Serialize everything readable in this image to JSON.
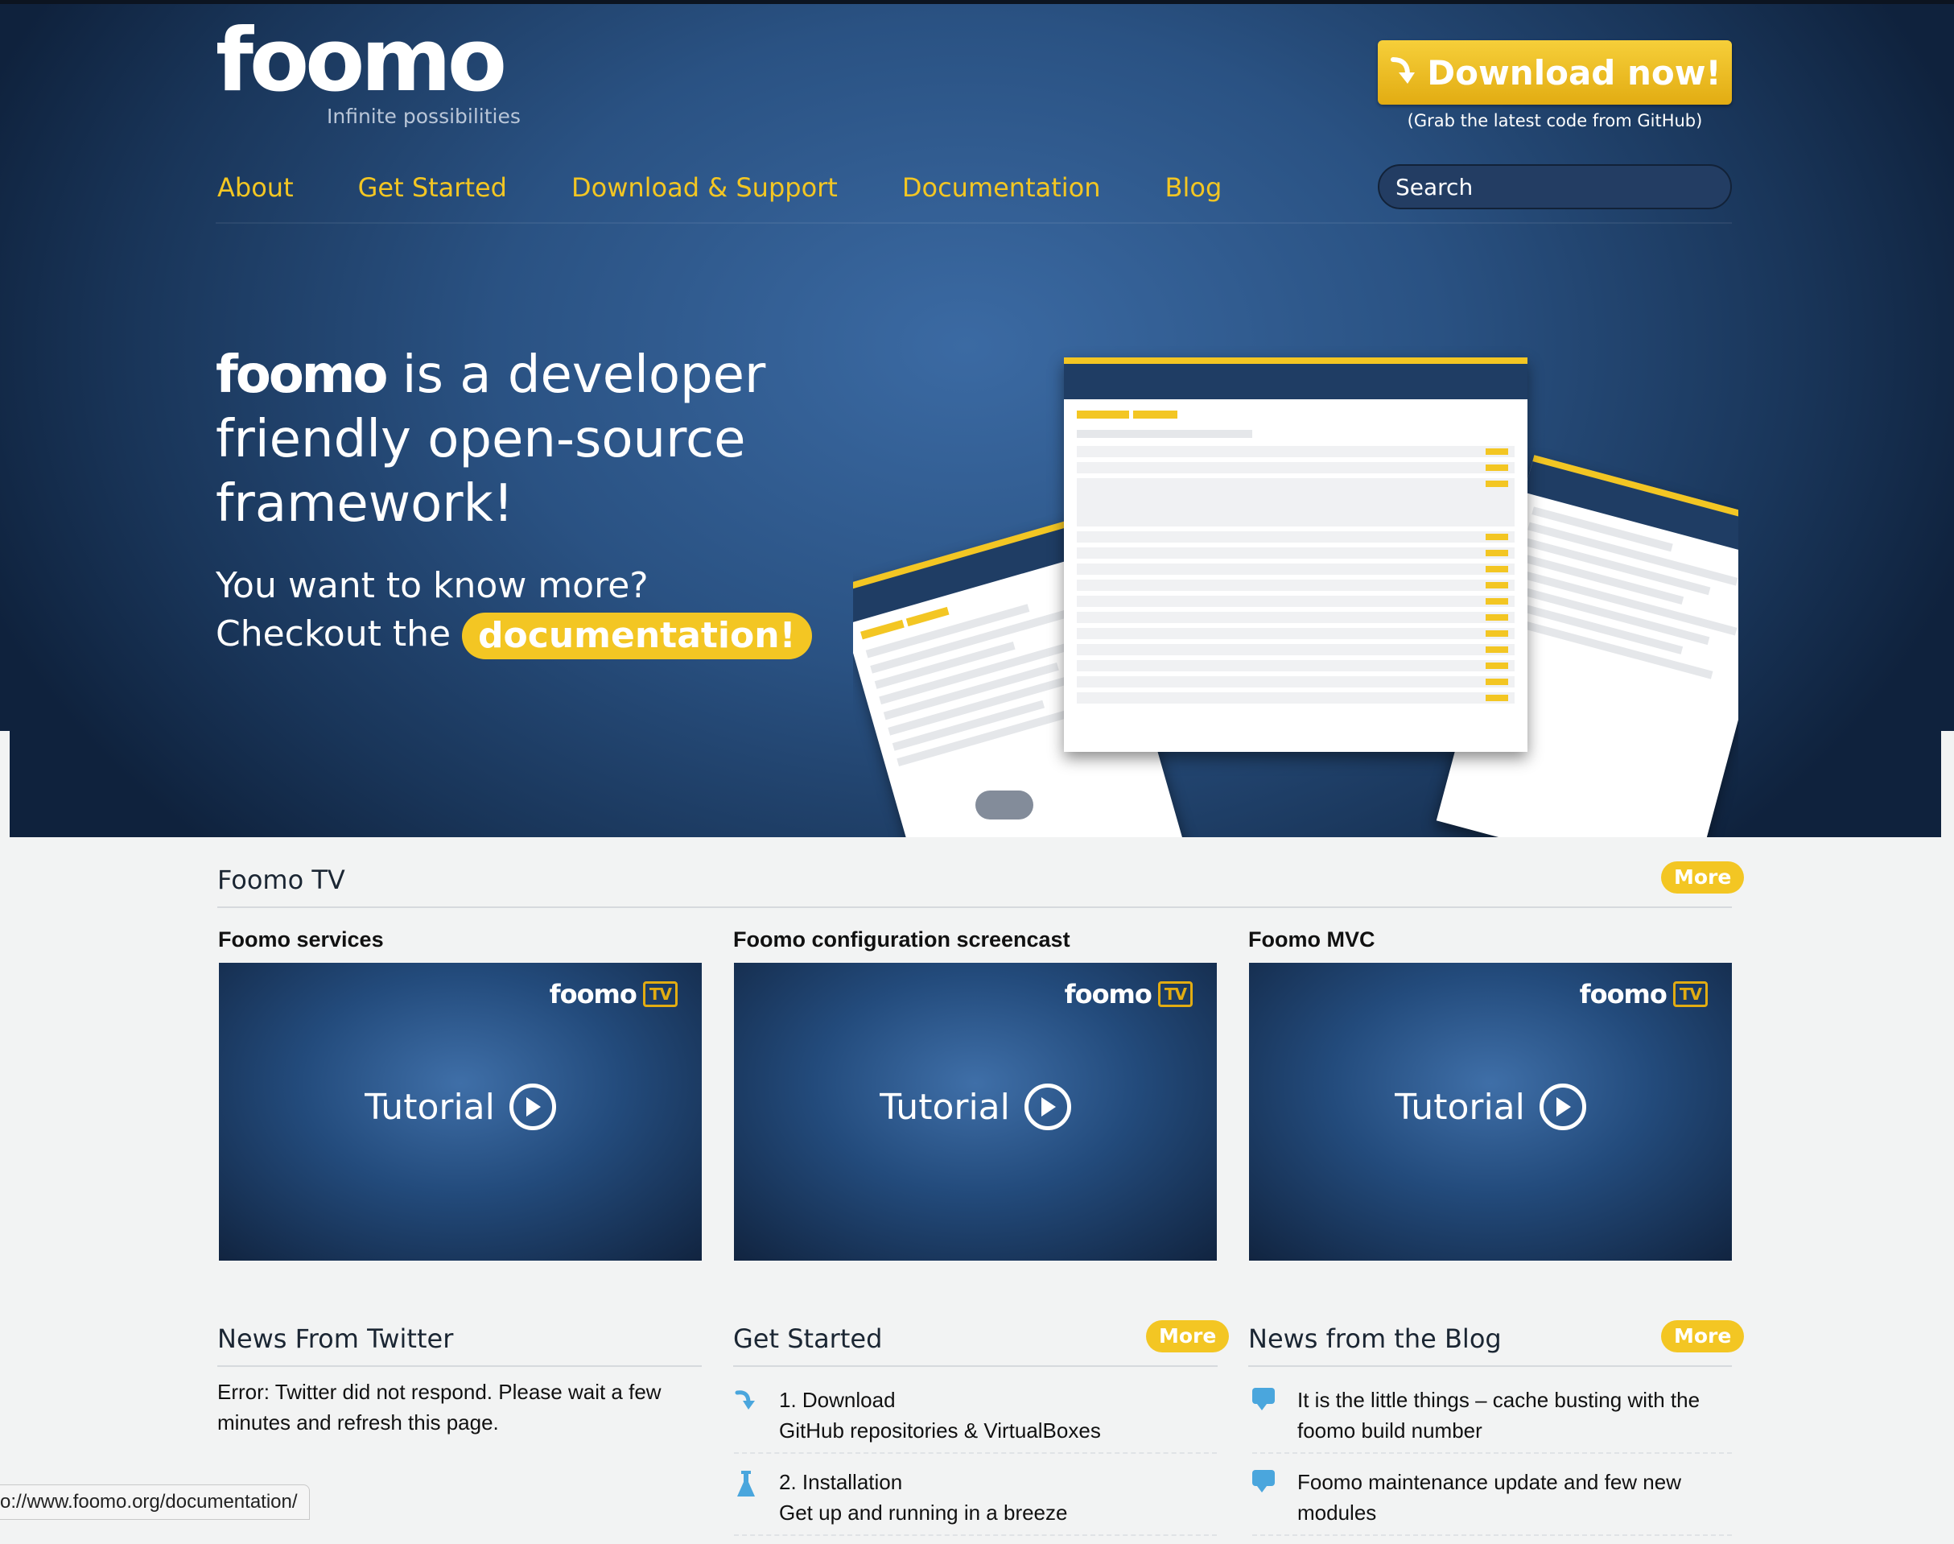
{
  "header": {
    "logo": "foomo",
    "tagline": "Infinite possibilities",
    "download_button": "Download now!",
    "download_sub": "(Grab the latest code from GitHub)",
    "search_placeholder": "Search"
  },
  "nav": {
    "items": [
      {
        "label": "About"
      },
      {
        "label": "Get Started"
      },
      {
        "label": "Download & Support"
      },
      {
        "label": "Documentation"
      },
      {
        "label": "Blog"
      }
    ]
  },
  "hero": {
    "headline_logo": "foomo",
    "headline_rest": " is a developer friendly open-source framework!",
    "more_line1": "You want to know more?",
    "more_line2_prefix": "Checkout the ",
    "doc_link": "documentation!"
  },
  "foomo_tv": {
    "title": "Foomo TV",
    "more_label": "More",
    "videos": [
      {
        "title": "Foomo services",
        "thumb_logo": "foomo",
        "thumb_badge": "TV",
        "thumb_text": "Tutorial"
      },
      {
        "title": "Foomo configuration screencast",
        "thumb_logo": "foomo",
        "thumb_badge": "TV",
        "thumb_text": "Tutorial"
      },
      {
        "title": "Foomo MVC",
        "thumb_logo": "foomo",
        "thumb_badge": "TV",
        "thumb_text": "Tutorial"
      }
    ]
  },
  "twitter": {
    "title": "News From Twitter",
    "message": "Error: Twitter did not respond. Please wait a few minutes and refresh this page."
  },
  "get_started": {
    "title": "Get Started",
    "more_label": "More",
    "items": [
      {
        "title": "1. Download",
        "subtitle": "GitHub repositories & VirtualBoxes",
        "icon": "arrow-icon"
      },
      {
        "title": "2. Installation",
        "subtitle": "Get up and running in a breeze",
        "icon": "flask-icon"
      }
    ]
  },
  "blog": {
    "title": "News from the Blog",
    "more_label": "More",
    "items": [
      {
        "text": "It is the little things – cache busting with the foomo build number",
        "icon": "speech-bubble-icon"
      },
      {
        "text": "Foomo maintenance update and few new modules",
        "icon": "speech-bubble-icon"
      }
    ]
  },
  "status_bar": {
    "url": "o://www.foomo.org/documentation/"
  },
  "colors": {
    "accent": "#f3c623",
    "hero_blue": "#2a5283",
    "background": "#f2f3f3"
  }
}
